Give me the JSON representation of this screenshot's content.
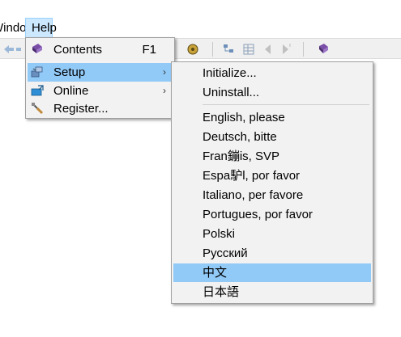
{
  "menubar": {
    "window_label": "Window",
    "help_label": "Help"
  },
  "help_menu": {
    "items": [
      {
        "label": "Contents",
        "shortcut": "F1",
        "icon": "book-icon"
      },
      {
        "label": "Setup",
        "arrow": "›",
        "icon": "setup-icon"
      },
      {
        "label": "Online",
        "arrow": "›",
        "icon": "online-icon"
      },
      {
        "label": "Register...",
        "icon": "register-icon"
      }
    ]
  },
  "setup_menu": {
    "items": [
      {
        "label": "Initialize..."
      },
      {
        "label": "Uninstall..."
      },
      {
        "label": "English, please"
      },
      {
        "label": "Deutsch, bitte"
      },
      {
        "label": "Fran鏰is, SVP"
      },
      {
        "label": "Espa馿l, por favor"
      },
      {
        "label": "Italiano, per favore"
      },
      {
        "label": "Portugues, por favor"
      },
      {
        "label": "Polski"
      },
      {
        "label": "Русский"
      },
      {
        "label": "中文"
      },
      {
        "label": "日本語"
      }
    ]
  },
  "colors": {
    "highlight": "#91c9f7",
    "menubar_highlight": "#cce8ff",
    "menu_bg": "#f2f2f2"
  }
}
